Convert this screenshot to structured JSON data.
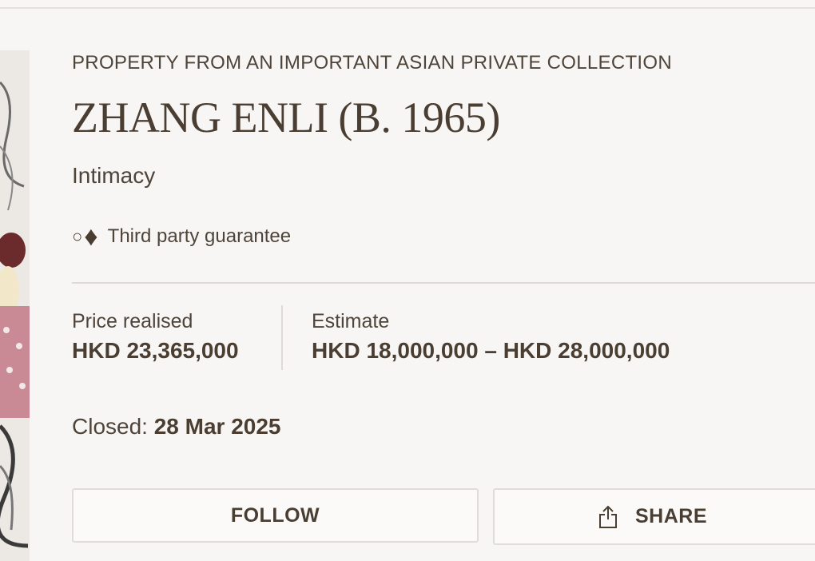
{
  "lot": {
    "collection": "PROPERTY FROM AN IMPORTANT ASIAN PRIVATE COLLECTION",
    "artist": "ZHANG ENLI (B. 1965)",
    "title": "Intimacy",
    "guarantee": {
      "symbol_circle": "○",
      "symbol_diamond": "♦",
      "text": "Third party guarantee"
    }
  },
  "pricing": {
    "price_label": "Price realised",
    "price_value": "HKD 23,365,000",
    "estimate_label": "Estimate",
    "estimate_value": "HKD 18,000,000 – HKD 28,000,000"
  },
  "status": {
    "closed_label": "Closed:",
    "closed_date": "28 Mar 2025"
  },
  "actions": {
    "follow_label": "FOLLOW",
    "share_label": "SHARE",
    "share_icon": "share-icon"
  },
  "colors": {
    "background": "#f8f6f4",
    "text": "#4a3e33",
    "border": "#e0dcd8"
  }
}
